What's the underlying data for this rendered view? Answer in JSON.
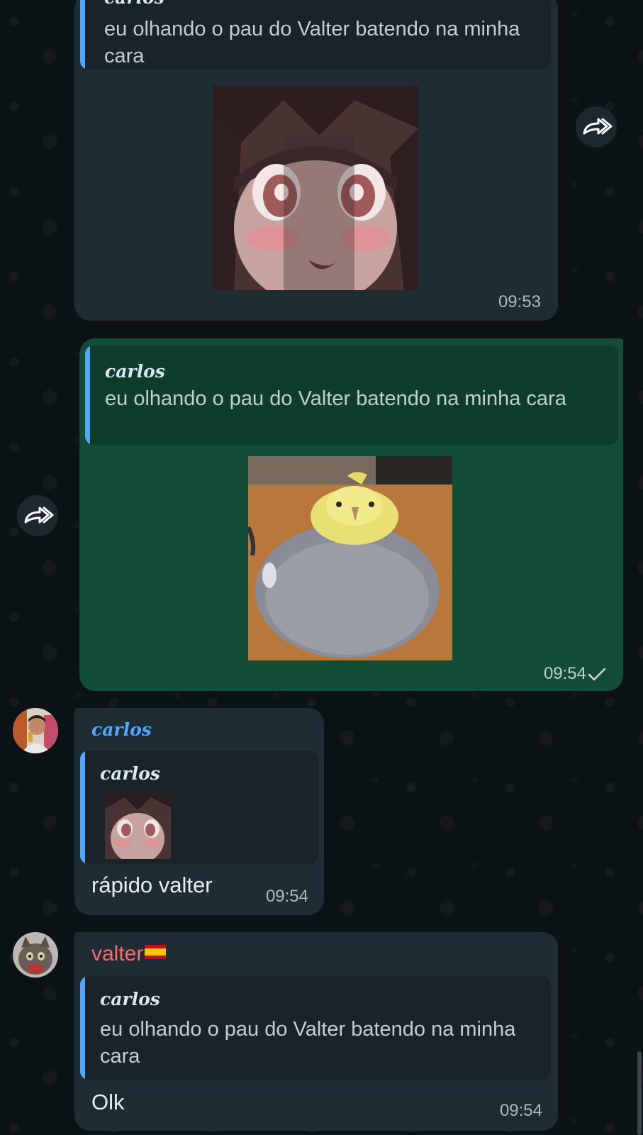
{
  "messages": [
    {
      "quote": {
        "sender": "carlos",
        "text": "eu olhando o pau do Valter batendo na minha cara"
      },
      "image": "anime-face-closeup",
      "time": "09:53"
    },
    {
      "quote": {
        "sender": "carlos",
        "text": "eu olhando o pau do Valter batendo na minha cara"
      },
      "image": "cockatiel-bird",
      "time": "09:54",
      "status": "✓"
    },
    {
      "sender": "carlos",
      "quote": {
        "sender": "carlos",
        "image": "anime-face-thumbnail"
      },
      "text": "rápido valter",
      "time": "09:54"
    },
    {
      "sender": "valter",
      "quote": {
        "sender": "carlos",
        "text": "eu olhando o pau do Valter batendo na minha cara"
      },
      "text": "Olk",
      "time": "09:54"
    }
  ],
  "icons": {
    "forward": "forward-arrow-icon",
    "read_status": "single-check-icon",
    "flag": "spain-flag-icon"
  },
  "colors": {
    "incoming_bubble": "#1f2c33",
    "outgoing_bubble": "#144d37",
    "quote_bar": "#53a6fd",
    "sender_blue": "#53a6fd",
    "sender_red": "#ff6b6b"
  }
}
